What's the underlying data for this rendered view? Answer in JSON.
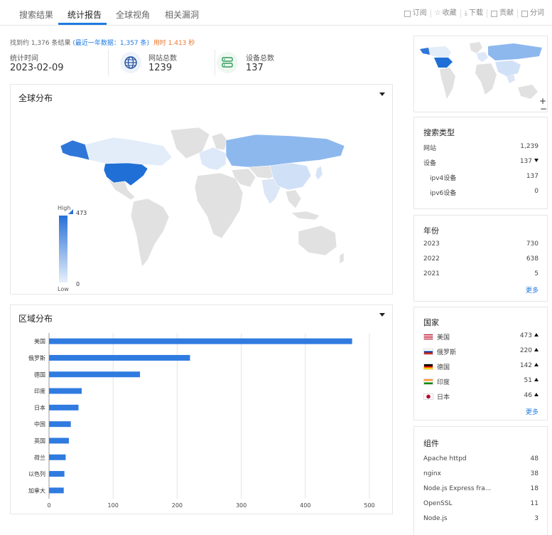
{
  "tabs": [
    {
      "label": "搜索结果"
    },
    {
      "label": "统计报告"
    },
    {
      "label": "全球视角"
    },
    {
      "label": "相关漏洞"
    }
  ],
  "actions": [
    {
      "label": "订阅"
    },
    {
      "label": "收藏"
    },
    {
      "label": "下载"
    },
    {
      "label": "贡献"
    },
    {
      "label": "分词"
    }
  ],
  "summary": {
    "found": "找到约 1,376 条结果",
    "recent": "(最近一年数据：1,357 条)",
    "time": "用时 1.413 秒"
  },
  "stats": {
    "time_label": "统计时间",
    "time_value": "2023-02-09",
    "sites_label": "网站总数",
    "sites_value": "1239",
    "devices_label": "设备总数",
    "devices_value": "137"
  },
  "global_panel": {
    "title": "全球分布",
    "legend_high": "High",
    "legend_low": "Low",
    "legend_max": "473",
    "legend_min": "0"
  },
  "region_panel": {
    "title": "区域分布"
  },
  "chart_data": {
    "type": "bar",
    "orientation": "horizontal",
    "categories": [
      "美国",
      "俄罗斯",
      "德国",
      "印度",
      "日本",
      "中国",
      "英国",
      "荷兰",
      "以色列",
      "加拿大"
    ],
    "values": [
      473,
      220,
      142,
      51,
      46,
      34,
      31,
      26,
      24,
      23
    ],
    "xticks": [
      "0",
      "100",
      "200",
      "300",
      "400",
      "500"
    ],
    "xlim": [
      0,
      500
    ],
    "grid": true,
    "color": "#2f7be0"
  },
  "search_type": {
    "title": "搜索类型",
    "rows": [
      {
        "label": "网站",
        "value": "1,239"
      },
      {
        "label": "设备",
        "value": "137"
      },
      {
        "label": "ipv4设备",
        "value": "137"
      },
      {
        "label": "ipv6设备",
        "value": "0"
      }
    ]
  },
  "year": {
    "title": "年份",
    "rows": [
      {
        "label": "2023",
        "value": "730"
      },
      {
        "label": "2022",
        "value": "638"
      },
      {
        "label": "2021",
        "value": "5"
      }
    ],
    "more": "更多"
  },
  "country": {
    "title": "国家",
    "rows": [
      {
        "label": "美国",
        "value": "473"
      },
      {
        "label": "俄罗斯",
        "value": "220"
      },
      {
        "label": "德国",
        "value": "142"
      },
      {
        "label": "印度",
        "value": "51"
      },
      {
        "label": "日本",
        "value": "46"
      }
    ],
    "more": "更多"
  },
  "component": {
    "title": "组件",
    "rows": [
      {
        "label": "Apache httpd",
        "value": "48"
      },
      {
        "label": "nginx",
        "value": "38"
      },
      {
        "label": "Node.js Express fra...",
        "value": "18"
      },
      {
        "label": "OpenSSL",
        "value": "11"
      },
      {
        "label": "Node.js",
        "value": "3"
      }
    ]
  },
  "minimap": {
    "zoom_in": "+",
    "zoom_out": "−"
  }
}
